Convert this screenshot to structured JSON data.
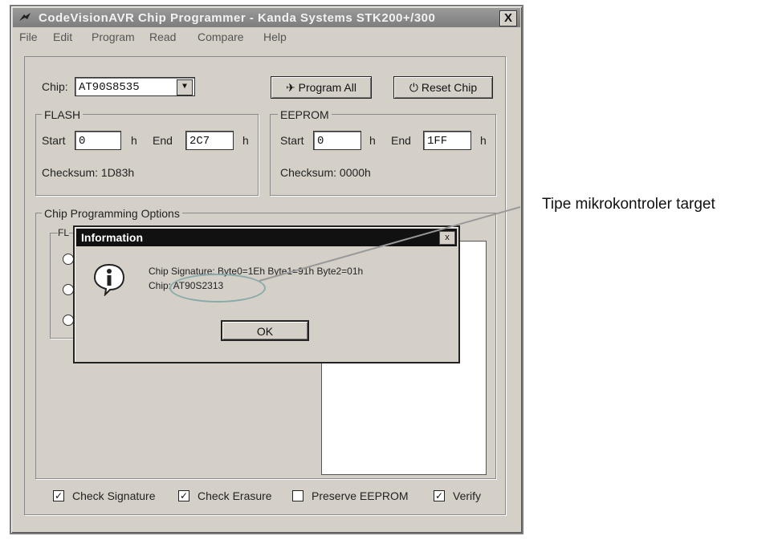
{
  "window": {
    "title": "CodeVisionAVR Chip Programmer - Kanda Systems STK200+/300",
    "close_label": "X"
  },
  "menu": [
    "File",
    "Edit",
    "Program",
    "Read",
    "Compare",
    "Help"
  ],
  "chip": {
    "label": "Chip:",
    "value": "AT90S8535"
  },
  "buttons": {
    "program_all": "Program All",
    "reset_chip": "Reset Chip"
  },
  "flash": {
    "title": "FLASH",
    "start_label": "Start",
    "start_value": "0",
    "h1": "h",
    "end_label": "End",
    "end_value": "2C7",
    "h2": "h",
    "checksum": "Checksum: 1D83h"
  },
  "eeprom": {
    "title": "EEPROM",
    "start_label": "Start",
    "start_value": "0",
    "h1": "h",
    "end_label": "End",
    "end_value": "1FF",
    "h2": "h",
    "checksum": "Checksum: 0000h"
  },
  "options": {
    "title": "Chip Programming Options",
    "sub_group_label": "FL"
  },
  "checks": [
    {
      "label": "Check Signature",
      "checked": true
    },
    {
      "label": "Check Erasure",
      "checked": true
    },
    {
      "label": "Preserve EEPROM",
      "checked": false
    },
    {
      "label": "Verify",
      "checked": true
    }
  ],
  "dialog": {
    "title": "Information",
    "close_label": "x",
    "line1": "Chip Signature: Byte0=1Eh Byte1=91h Byte2=01h",
    "line2": "Chip: AT90S2313",
    "ok": "OK"
  },
  "annotation": {
    "text": "Tipe mikrokontroler target"
  }
}
